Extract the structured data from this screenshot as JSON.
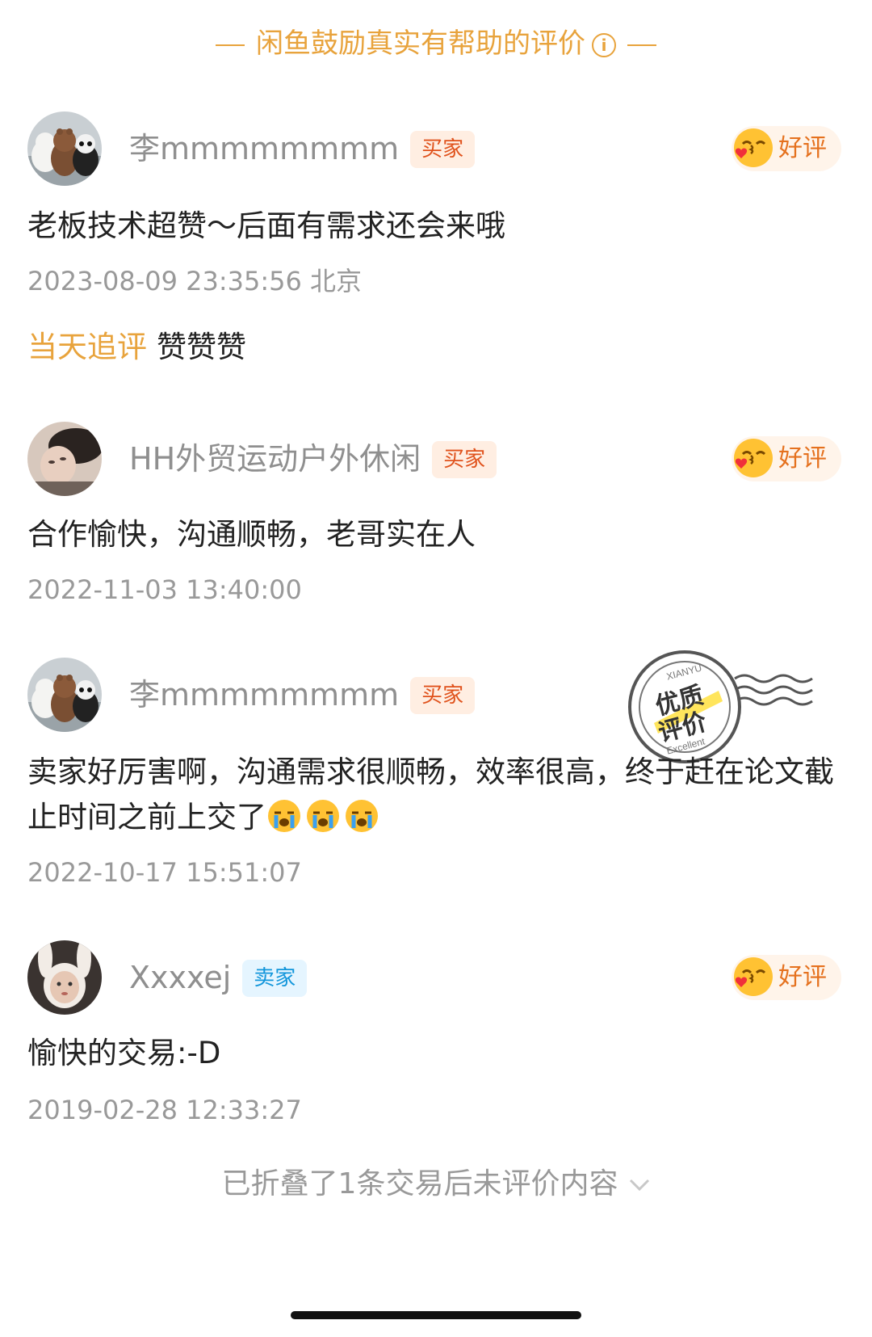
{
  "banner": {
    "text": "闲鱼鼓励真实有帮助的评价",
    "icon": "info-icon"
  },
  "reviews": [
    {
      "username": "李mmmmmmmm",
      "role": "买家",
      "rating": "好评",
      "content": "老板技术超赞～后面有需求还会来哦",
      "time": "2023-08-09 23:35:56 北京",
      "followup": {
        "label": "当天追评",
        "text": "赞赞赞"
      }
    },
    {
      "username": "HH外贸运动户外休闲",
      "role": "买家",
      "rating": "好评",
      "content": "合作愉快，沟通顺畅，老哥实在人",
      "time": "2022-11-03 13:40:00"
    },
    {
      "username": "李mmmmmmmm",
      "role": "买家",
      "content": "卖家好厉害啊，沟通需求很顺畅，效率很高，终于赶在论文截止时间之前上交了",
      "time": "2022-10-17 15:51:07",
      "badge": {
        "top": "XIANYU",
        "main1": "优质",
        "main2": "评价",
        "bottom": "Excellent"
      }
    },
    {
      "username": "Xxxxej",
      "role": "卖家",
      "rating": "好评",
      "content": "愉快的交易:-D",
      "time": "2019-02-28 12:33:27"
    }
  ],
  "folded": {
    "text": "已折叠了1条交易后未评价内容",
    "icon": "chevron-down-icon"
  },
  "colors": {
    "accent": "#E8A33C",
    "buyer_tag": "#E0521C",
    "seller_tag": "#1296DB",
    "rating": "#E5711E"
  }
}
